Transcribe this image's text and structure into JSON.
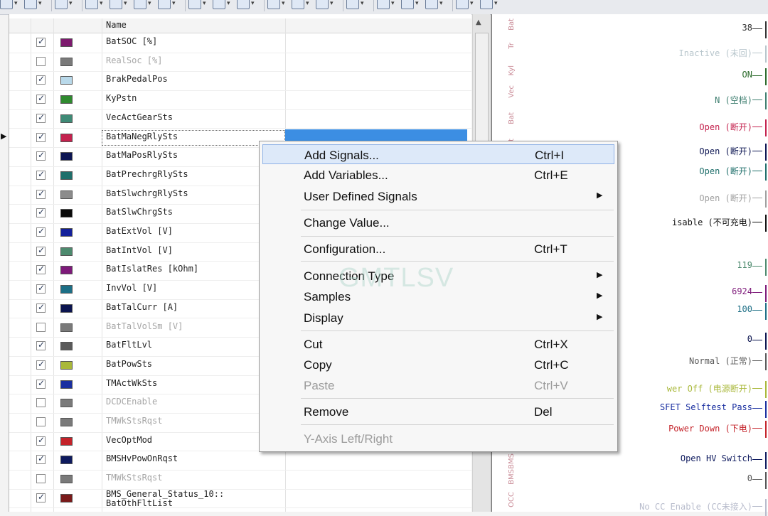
{
  "toolbar": {
    "icons": [
      "layout-icon",
      "pause-icon",
      "axis-icon",
      "graph-icon",
      "signal-icon",
      "curve-icon",
      "cursor-icon",
      "zoom-in-icon",
      "zoom-out-icon",
      "zoom-fit-icon",
      "chart-icon",
      "measure-icon",
      "marker-icon",
      "window-icon",
      "undo-icon",
      "redo-icon",
      "export-icon",
      "print-icon",
      "pointer-icon"
    ]
  },
  "signal_list": {
    "header_name": "Name",
    "rows": [
      {
        "name": "BatSOC [%]",
        "checked": true,
        "color": "#7d1a6e",
        "dim": false
      },
      {
        "name": "RealSoc [%]",
        "checked": false,
        "color": "#7a7a7a",
        "dim": true
      },
      {
        "name": "BrakPedalPos",
        "checked": true,
        "color": "#b9d9ea",
        "dim": false
      },
      {
        "name": "KyPstn",
        "checked": true,
        "color": "#2f8a2f",
        "dim": false
      },
      {
        "name": "VecActGearSts",
        "checked": true,
        "color": "#3f8a76",
        "dim": false
      },
      {
        "name": "BatMaNegRlySts",
        "checked": true,
        "color": "#c4224e",
        "dim": false
      },
      {
        "name": "BatMaPosRlySts",
        "checked": true,
        "color": "#0c1552",
        "dim": false
      },
      {
        "name": "BatPrechrgRlySts",
        "checked": true,
        "color": "#1f6f6b",
        "dim": false
      },
      {
        "name": "BatSlwchrgRlySts",
        "checked": true,
        "color": "#8c8c8c",
        "dim": false
      },
      {
        "name": "BatSlwChrgSts",
        "checked": true,
        "color": "#0a0a0a",
        "dim": false
      },
      {
        "name": "BatExtVol [V]",
        "checked": true,
        "color": "#13209a",
        "dim": false
      },
      {
        "name": "BatIntVol [V]",
        "checked": true,
        "color": "#4d8a6e",
        "dim": false
      },
      {
        "name": "BatIslatRes [kOhm]",
        "checked": true,
        "color": "#7e1a7a",
        "dim": false
      },
      {
        "name": "InvVol [V]",
        "checked": true,
        "color": "#1d6f86",
        "dim": false
      },
      {
        "name": "BatTalCurr [A]",
        "checked": true,
        "color": "#0b144f",
        "dim": false
      },
      {
        "name": "BatTalVolSm [V]",
        "checked": false,
        "color": "#7a7a7a",
        "dim": true
      },
      {
        "name": "BatFltLvl",
        "checked": true,
        "color": "#5a5a5a",
        "dim": false
      },
      {
        "name": "BatPowSts",
        "checked": true,
        "color": "#a9b83a",
        "dim": false
      },
      {
        "name": "TMActWkSts",
        "checked": true,
        "color": "#1a2fa0",
        "dim": false
      },
      {
        "name": "DCDCEnable",
        "checked": false,
        "color": "#7a7a7a",
        "dim": true
      },
      {
        "name": "TMWkStsRqst",
        "checked": false,
        "color": "#7a7a7a",
        "dim": true
      },
      {
        "name": "VecOptMod",
        "checked": true,
        "color": "#c4232a",
        "dim": false
      },
      {
        "name": "BMSHvPowOnRqst",
        "checked": true,
        "color": "#0e1a5e",
        "dim": false
      },
      {
        "name": "TMWkStsRqst",
        "checked": false,
        "color": "#7a7a7a",
        "dim": true
      },
      {
        "name": "BMS_General_Status_10::\nBatOthFltList",
        "checked": true,
        "color": "#7a1a1a",
        "dim": false
      }
    ]
  },
  "context_menu": {
    "items": [
      {
        "label": "Add Signals...",
        "shortcut": "Ctrl+I",
        "arrow": "",
        "disabled": false,
        "highlighted": true
      },
      {
        "label": "Add Variables...",
        "shortcut": "Ctrl+E",
        "arrow": "",
        "disabled": false,
        "highlighted": false
      },
      {
        "label": "User Defined Signals",
        "shortcut": "",
        "arrow": "▶",
        "disabled": false,
        "highlighted": false
      },
      {
        "label": "Change Value...",
        "shortcut": "",
        "arrow": "",
        "disabled": false,
        "highlighted": false
      },
      {
        "label": "Configuration...",
        "shortcut": "Ctrl+T",
        "arrow": "",
        "disabled": false,
        "highlighted": false
      },
      {
        "label": "Connection Type",
        "shortcut": "",
        "arrow": "▶",
        "disabled": false,
        "highlighted": false
      },
      {
        "label": "Samples",
        "shortcut": "",
        "arrow": "▶",
        "disabled": false,
        "highlighted": false
      },
      {
        "label": "Display",
        "shortcut": "",
        "arrow": "▶",
        "disabled": false,
        "highlighted": false
      },
      {
        "label": "Cut",
        "shortcut": "Ctrl+X",
        "arrow": "",
        "disabled": false,
        "highlighted": false
      },
      {
        "label": "Copy",
        "shortcut": "Ctrl+C",
        "arrow": "",
        "disabled": false,
        "highlighted": false
      },
      {
        "label": "Paste",
        "shortcut": "Ctrl+V",
        "arrow": "",
        "disabled": true,
        "highlighted": false
      },
      {
        "label": "Remove",
        "shortcut": "Del",
        "arrow": "",
        "disabled": false,
        "highlighted": false
      },
      {
        "label": "Y-Axis Left/Right",
        "shortcut": "",
        "arrow": "",
        "disabled": true,
        "highlighted": false
      }
    ]
  },
  "graph_panel": {
    "axis_labels": [
      "Bat",
      "Tr",
      "Kyl",
      "Vec",
      "Bat",
      "Bat",
      "BMS BI",
      "BMS",
      "OCC"
    ],
    "values": [
      {
        "text": "38",
        "color": "#333333"
      },
      {
        "text": "Inactive (未回)",
        "color": "#b8c6cc"
      },
      {
        "text": "ON",
        "color": "#2c6b2c"
      },
      {
        "text": "N (空档)",
        "color": "#3f7f70"
      },
      {
        "text": "Open (断开)",
        "color": "#c4224e"
      },
      {
        "text": "Open (断开)",
        "color": "#0c1552"
      },
      {
        "text": "Open (断开)",
        "color": "#1f6f6b"
      },
      {
        "text": "Open (断开)",
        "color": "#a0a0a0"
      },
      {
        "text": "isable (不可充电)",
        "color": "#111111"
      },
      {
        "text": "119",
        "color": "#4d8a6e"
      },
      {
        "text": "6924",
        "color": "#7e1a7a"
      },
      {
        "text": "100",
        "color": "#1d6f86"
      },
      {
        "text": "0",
        "color": "#0b144f"
      },
      {
        "text": "Normal (正常)",
        "color": "#5a5a5a"
      },
      {
        "text": "wer Off (电源断开)",
        "color": "#a9b83a"
      },
      {
        "text": "SFET Selftest Pass",
        "color": "#1a2fa0"
      },
      {
        "text": "Power Down (下电)",
        "color": "#c4232a"
      },
      {
        "text": "Open HV Switch",
        "color": "#0e1a5e"
      },
      {
        "text": "0",
        "color": "#555555"
      },
      {
        "text": "No CC Enable (CC未接入)",
        "color": "#b8bccc"
      }
    ]
  },
  "watermark": "GMTLSV"
}
